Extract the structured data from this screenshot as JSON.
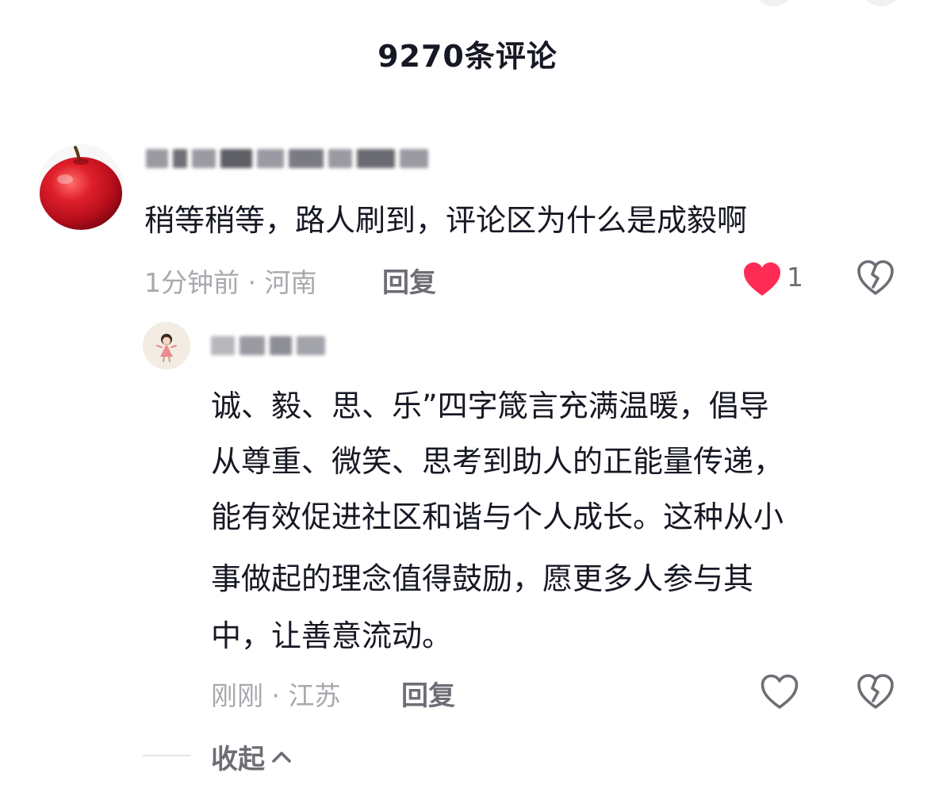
{
  "header": {
    "title": "9270条评论"
  },
  "comment": {
    "username": "",
    "text": "稍等稍等，路人刷到，评论区为什么是成毅啊",
    "time_location": "1分钟前 · 河南",
    "reply_label": "回复",
    "like_count": "1",
    "liked": true,
    "avatar_icon": "apple-avatar"
  },
  "reply": {
    "username": "",
    "text_lines": [
      "诚、毅、思、乐”四字箴言充满温暖，倡导",
      "从尊重、微笑、思考到助人的正能量传递，",
      "能有效促进社区和谐与个人成长。这种从小",
      "事做起的理念值得鼓励，愿更多人参与其",
      "中，让善意流动。"
    ],
    "time_location": "刚刚 · 江苏",
    "reply_label": "回复",
    "avatar_icon": "cartoon-girl-avatar"
  },
  "collapse": {
    "label": "收起"
  },
  "colors": {
    "like_active": "#fe2c55",
    "meta": "#a8a9ae",
    "action": "#6d6e75"
  }
}
